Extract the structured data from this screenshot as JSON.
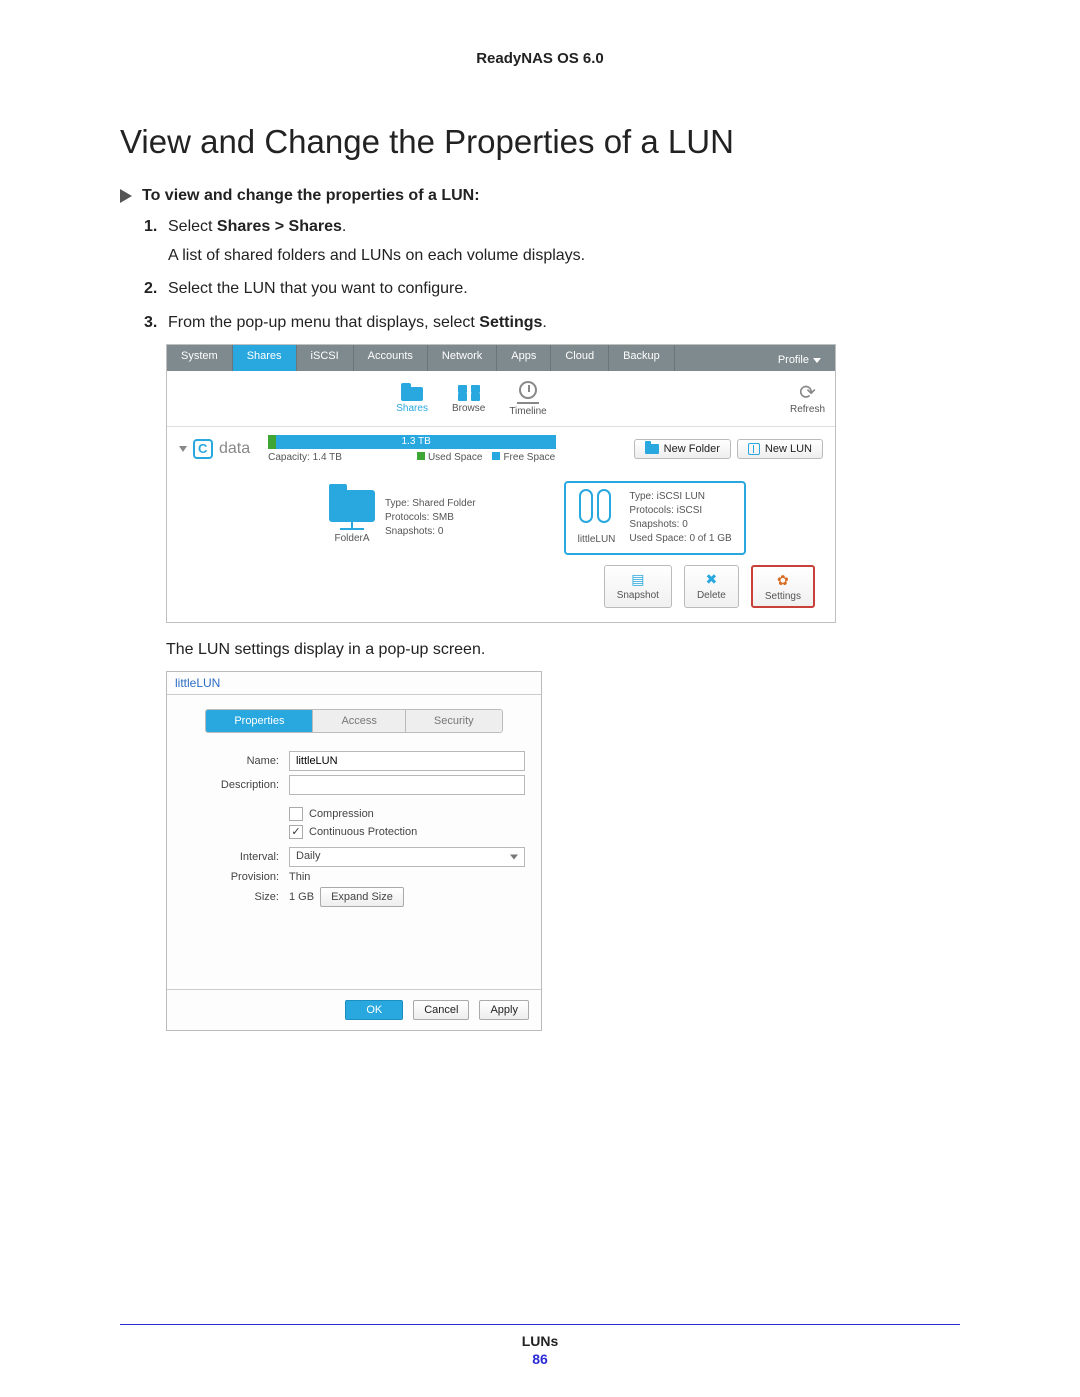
{
  "header": {
    "product": "ReadyNAS OS 6.0"
  },
  "title": "View and Change the Properties of a LUN",
  "procedure_heading": "To view and change the properties of a LUN:",
  "steps": {
    "s1_pre": "Select ",
    "s1_bold": "Shares > Shares",
    "s1_post": ".",
    "s1_line2": "A list of shared folders and LUNs on each volume displays.",
    "s2": "Select the LUN that you want to configure.",
    "s3_pre": "From the pop-up menu that displays, select ",
    "s3_bold": "Settings",
    "s3_post": "."
  },
  "shot1": {
    "nav": [
      "System",
      "Shares",
      "iSCSI",
      "Accounts",
      "Network",
      "Apps",
      "Cloud",
      "Backup"
    ],
    "nav_active_index": 1,
    "profile": "Profile",
    "toolbar": {
      "shares": "Shares",
      "browse": "Browse",
      "timeline": "Timeline",
      "refresh": "Refresh"
    },
    "volume": {
      "name": "data",
      "capacity_label": "Capacity: 1.4 TB",
      "bar_label": "1.3 TB",
      "legend_used": "Used Space",
      "legend_free": "Free Space"
    },
    "buttons": {
      "new_folder": "New Folder",
      "new_lun": "New LUN"
    },
    "folder_card": {
      "name": "FolderA",
      "type": "Type: Shared Folder",
      "protocols": "Protocols: SMB",
      "snapshots": "Snapshots: 0"
    },
    "lun_card": {
      "name": "littleLUN",
      "type": "Type: iSCSI LUN",
      "protocols": "Protocols: iSCSI",
      "snapshots": "Snapshots: 0",
      "used": "Used Space: 0 of 1 GB"
    },
    "sel": {
      "snapshot": "Snapshot",
      "delete": "Delete",
      "settings": "Settings"
    }
  },
  "mid_text": "The LUN settings display in a pop-up screen.",
  "shot2": {
    "dialog_title": "littleLUN",
    "tabs": [
      "Properties",
      "Access",
      "Security"
    ],
    "tabs_active_index": 0,
    "labels": {
      "name": "Name:",
      "description": "Description:",
      "interval": "Interval:",
      "provision": "Provision:",
      "size": "Size:"
    },
    "values": {
      "name": "littleLUN",
      "description": "",
      "interval": "Daily",
      "provision": "Thin",
      "size": "1 GB"
    },
    "checkboxes": {
      "compression": {
        "label": "Compression",
        "checked": false
      },
      "continuous": {
        "label": "Continuous Protection",
        "checked": true
      }
    },
    "expand_btn": "Expand Size",
    "footer": {
      "ok": "OK",
      "cancel": "Cancel",
      "apply": "Apply"
    }
  },
  "footer": {
    "section": "LUNs",
    "page": "86"
  }
}
